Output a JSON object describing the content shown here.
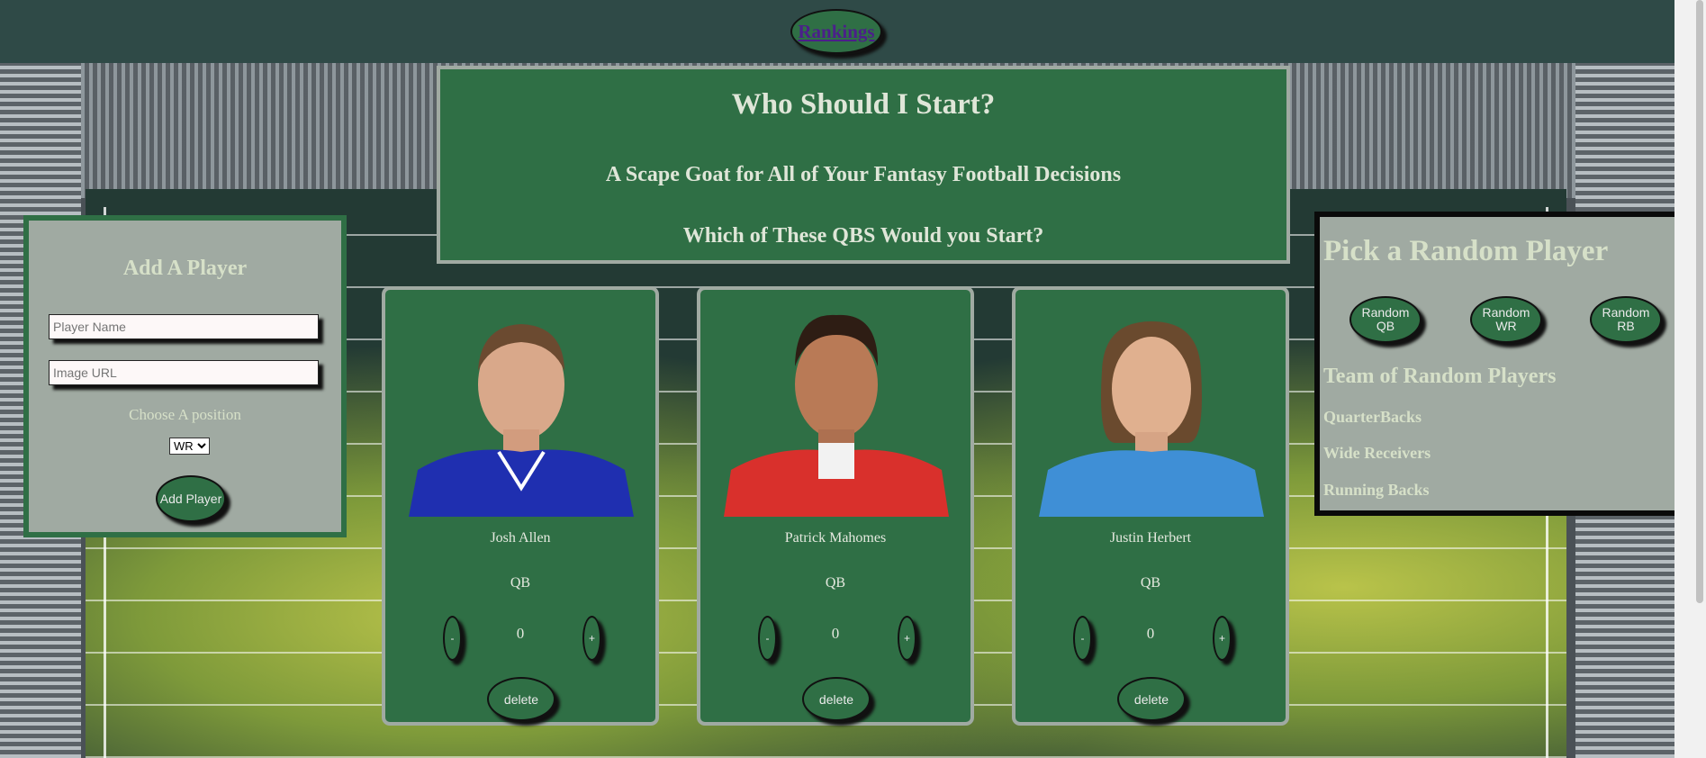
{
  "nav": {
    "rankings_label": "Rankings"
  },
  "header": {
    "title": "Who Should I Start?",
    "subtitle": "A Scape Goat for All of Your Fantasy Football Decisions",
    "question": "Which of These QBS Would you Start?"
  },
  "add_player": {
    "title": "Add A Player",
    "name_placeholder": "Player Name",
    "image_placeholder": "Image URL",
    "choose_label": "Choose A position",
    "position_selected": "WR",
    "button_label": "Add Player"
  },
  "players": [
    {
      "name": "Josh Allen",
      "position": "QB",
      "score": "0",
      "minus": "-",
      "plus": "+",
      "delete": "delete",
      "jersey_color": "#1f2fb0"
    },
    {
      "name": "Patrick Mahomes",
      "position": "QB",
      "score": "0",
      "minus": "-",
      "plus": "+",
      "delete": "delete",
      "jersey_color": "#d9302c"
    },
    {
      "name": "Justin Herbert",
      "position": "QB",
      "score": "0",
      "minus": "-",
      "plus": "+",
      "delete": "delete",
      "jersey_color": "#3f8fd6"
    }
  ],
  "random": {
    "title": "Pick a Random Player",
    "qb_button": "Random QB",
    "wr_button": "Random WR",
    "rb_button": "Random RB",
    "team_title": "Team of Random Players",
    "quarterbacks": "QuarterBacks",
    "wide_receivers": "Wide Receivers",
    "running_backs": "Running Backs"
  }
}
